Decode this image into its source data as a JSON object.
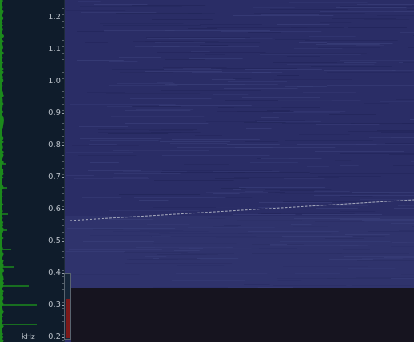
{
  "axis": {
    "unit": "kHz",
    "ticks": [
      "1.2",
      "1.1",
      "1.0",
      "0.9",
      "0.8",
      "0.7",
      "0.6",
      "0.5",
      "0.4",
      "0.3",
      "0.2"
    ]
  },
  "level_meter": {
    "level_fraction": 0.62,
    "fill_color": "#7c1a1a"
  },
  "waterfall": {
    "background_color": "#2a2d66",
    "trace_color": "#bfc3cf",
    "trace_start_khz": 0.565,
    "trace_end_khz": 0.63
  },
  "colors": {
    "panel_bg": "#0f1c2b",
    "spectrum_green": "#1c8a1c",
    "empty_region": "#16141f"
  }
}
